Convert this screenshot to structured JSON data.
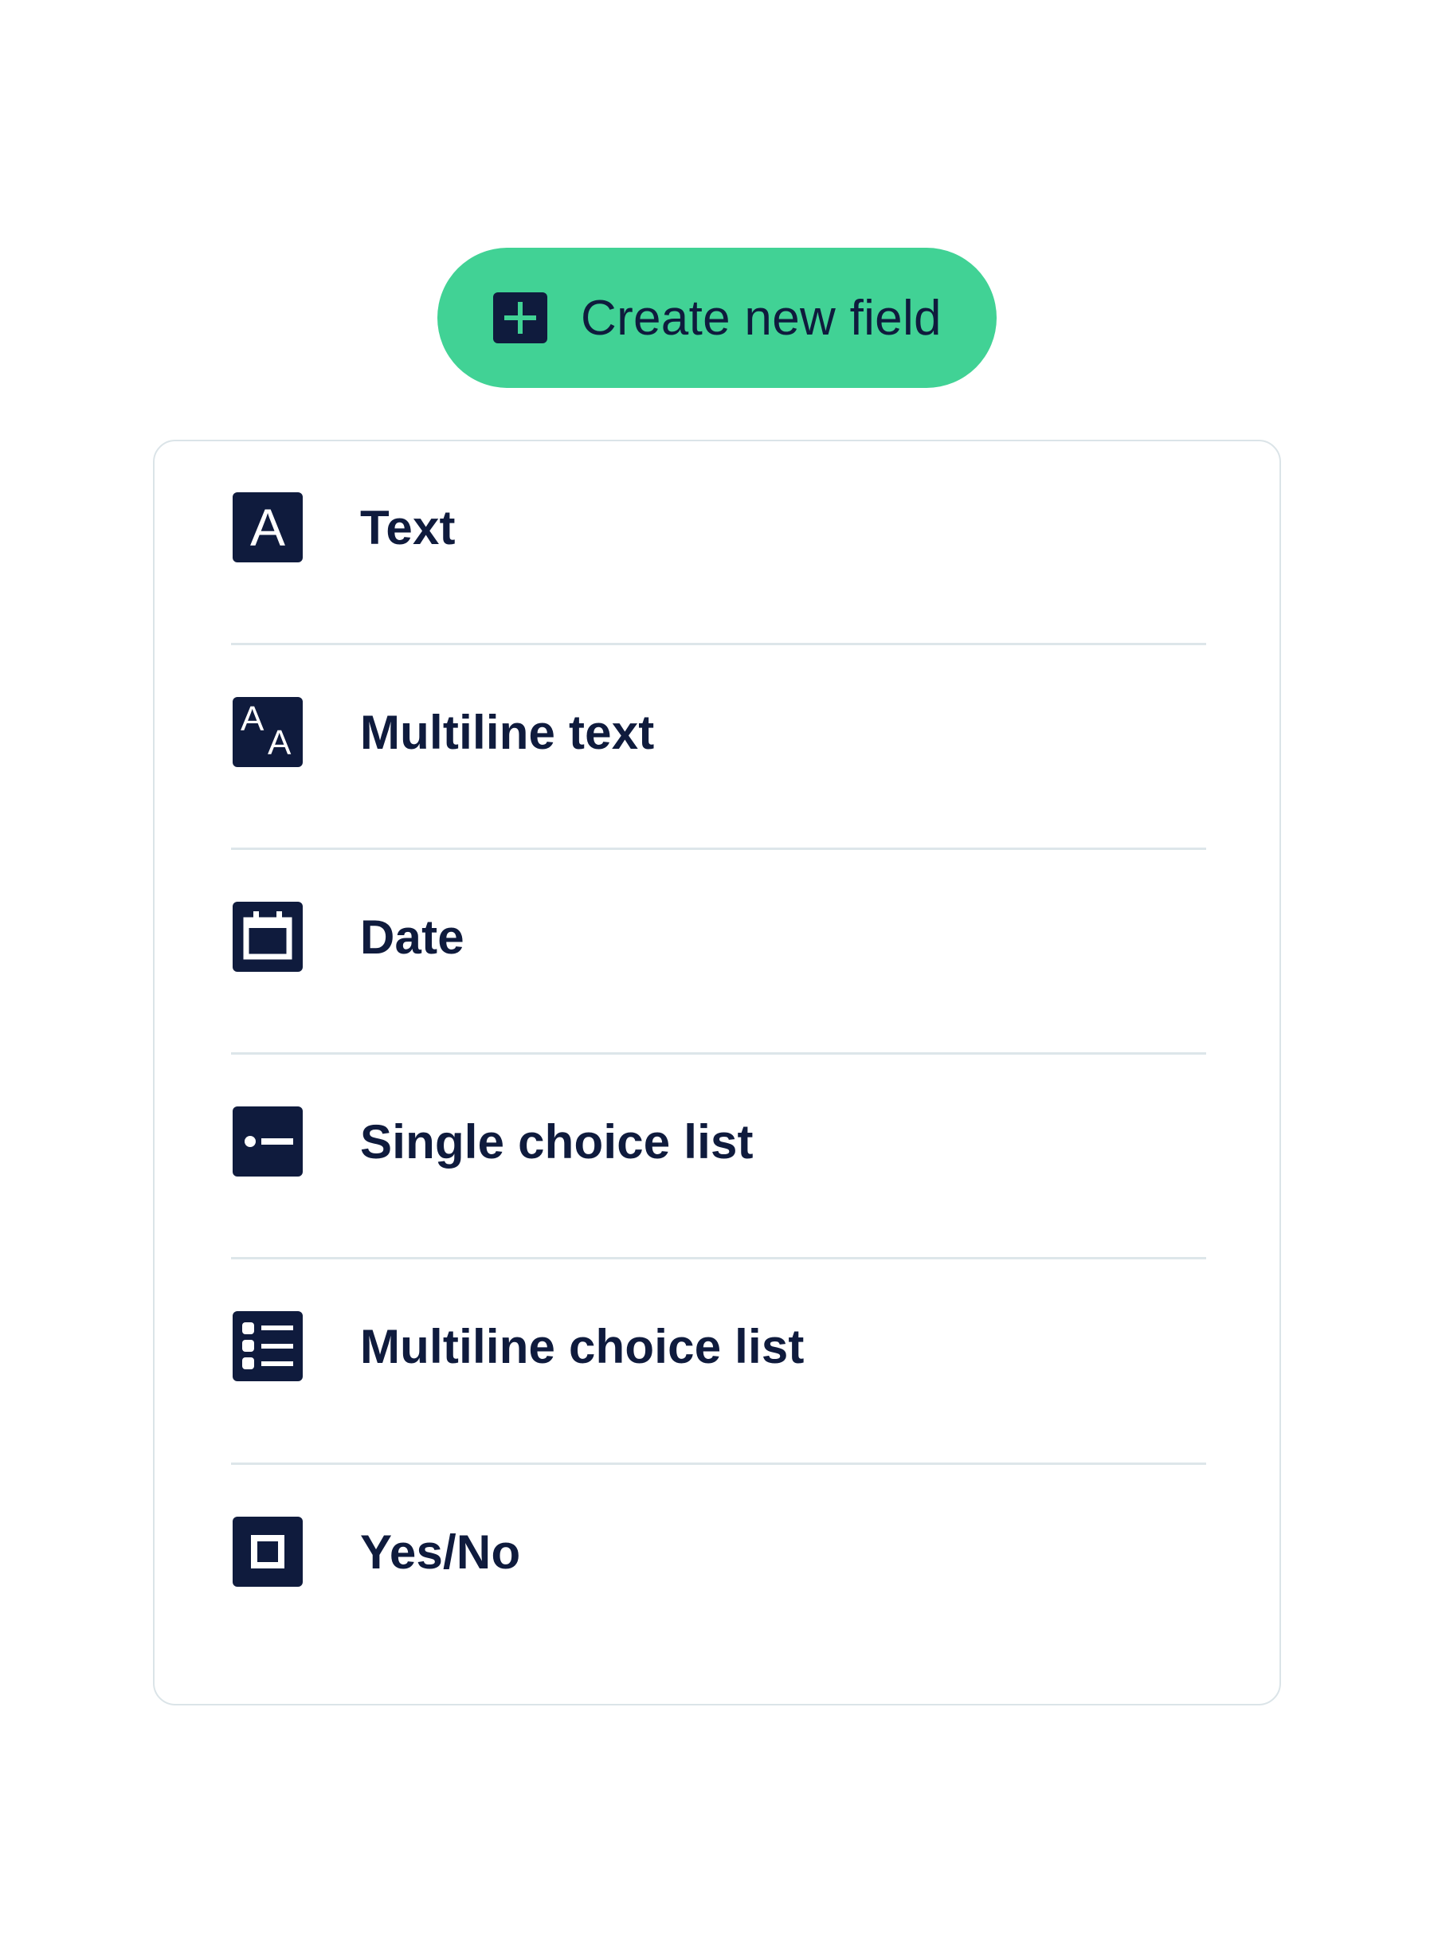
{
  "create_button": {
    "label": "Create new field",
    "icon": "plus-icon"
  },
  "fields": [
    {
      "label": "Text",
      "icon": "text-icon"
    },
    {
      "label": "Multiline text",
      "icon": "multiline-text-icon"
    },
    {
      "label": "Date",
      "icon": "calendar-icon"
    },
    {
      "label": "Single choice list",
      "icon": "single-choice-icon"
    },
    {
      "label": "Multiline choice list",
      "icon": "multi-choice-list-icon"
    },
    {
      "label": "Yes/No",
      "icon": "checkbox-icon"
    }
  ],
  "icon_glyphs": {
    "text": "A",
    "multiline_a_upper": "A",
    "multiline_a_lower": "A"
  },
  "colors": {
    "accent": "#41d295",
    "ink": "#0f1b3d",
    "border": "#dbe4e8"
  }
}
